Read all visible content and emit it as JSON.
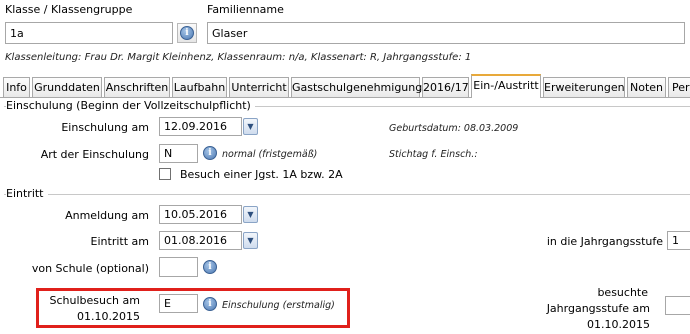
{
  "header": {
    "class_label": "Klasse / Klassengruppe",
    "class_value": "1a",
    "family_label": "Familienname",
    "family_value": "Glaser",
    "class_info": "Klassenleitung: Frau Dr. Margit Kleinhenz, Klassenraum: n/a, Klassenart: R, Jahrgangsstufe: 1"
  },
  "tabs": [
    "Info",
    "Grunddaten",
    "Anschriften",
    "Laufbahn",
    "Unterricht",
    "Gastschulgenehmigung",
    "2016/17",
    "Ein-/Austritt",
    "Erweiterungen",
    "Noten",
    "Per"
  ],
  "einschulung": {
    "group_title": "Einschulung (Beginn der Vollzeitschulpflicht)",
    "am_label": "Einschulung am",
    "am_value": "12.09.2016",
    "birth_label": "Geburtsdatum: 08.03.2009",
    "art_label": "Art der Einschulung",
    "art_value": "N",
    "art_desc": "normal (fristgemäß)",
    "stichtag_label": "Stichtag f. Einsch.:",
    "checkbox_label": "Besuch einer Jgst. 1A bzw. 2A"
  },
  "eintritt": {
    "group_title": "Eintritt",
    "anmeldung_label": "Anmeldung am",
    "anmeldung_value": "10.05.2016",
    "eintritt_label": "Eintritt am",
    "eintritt_value": "01.08.2016",
    "jgst_label": "in die Jahrgangsstufe",
    "jgst_value": "1",
    "von_schule_label": "von Schule (optional)",
    "von_schule_value": "",
    "schulbesuch_label_1": "Schulbesuch am",
    "schulbesuch_label_2": "01.10.2015",
    "schulbesuch_value": "E",
    "schulbesuch_desc": "Einschulung (erstmalig)",
    "besuchte_label_1": "besuchte",
    "besuchte_label_2": "Jahrgangsstufe am",
    "besuchte_label_3": "01.10.2015",
    "besuchte_value": ""
  },
  "colors": {
    "highlight_box": "#e0201b",
    "active_tab_accent": "#e8a93a",
    "info_icon": "#4c78b2"
  }
}
